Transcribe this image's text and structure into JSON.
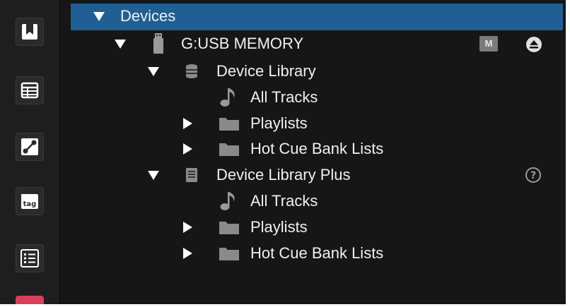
{
  "toolbar": {
    "buttons": [
      {
        "icon": "bookmark-icon"
      },
      {
        "icon": "table-icon"
      },
      {
        "icon": "link-icon"
      },
      {
        "icon": "tag-icon"
      },
      {
        "icon": "list-icon"
      },
      {
        "icon": "red-icon"
      }
    ]
  },
  "tree": {
    "root": {
      "label": "Devices"
    },
    "device": {
      "label": "G:USB MEMORY",
      "badge": "M"
    },
    "library": {
      "label": "Device Library",
      "all_tracks": "All Tracks",
      "playlists": "Playlists",
      "hot_cue": "Hot Cue Bank Lists"
    },
    "library_plus": {
      "label": "Device Library Plus",
      "help": "?",
      "all_tracks": "All Tracks",
      "playlists": "Playlists",
      "hot_cue": "Hot Cue Bank Lists"
    }
  },
  "colors": {
    "background": "#161616",
    "selected_row": "#1f5f93",
    "text": "#f0f0f0"
  }
}
